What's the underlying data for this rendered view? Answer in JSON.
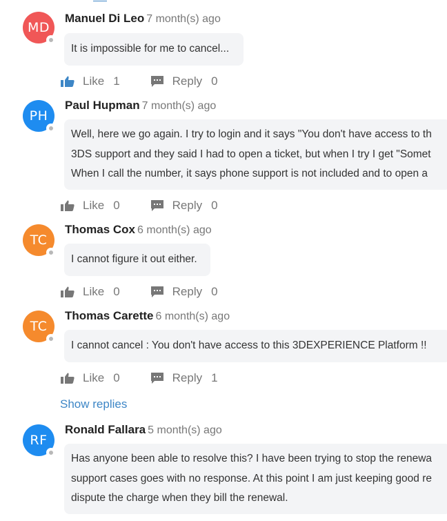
{
  "colors": {
    "avatar_red": "#f05757",
    "avatar_blue": "#1e8cf0",
    "avatar_orange": "#f58a2d",
    "link_blue": "#3d86c6",
    "like_active_blue": "#3d86c6",
    "icon_gray": "#777777",
    "bubble_bg": "#f3f4f6"
  },
  "labels": {
    "like": "Like",
    "reply": "Reply",
    "show_replies": "Show replies"
  },
  "comments": [
    {
      "initials": "MD",
      "author": "Manuel Di Leo",
      "time": "7 month(s) ago",
      "lines": [
        "It is impossible for me to cancel..."
      ],
      "likes": "1",
      "replies": "0",
      "liked": true
    },
    {
      "initials": "PH",
      "author": "Paul Hupman",
      "time": "7 month(s) ago",
      "lines": [
        "Well, here we go again. I try to login and it says \"You don't have access to th",
        "3DS support and they said I had to open a ticket, but when I try I get \"Somet",
        "When I call the number, it says phone support is not included and to open a"
      ],
      "likes": "0",
      "replies": "0",
      "liked": false
    },
    {
      "initials": "TC",
      "author": "Thomas Cox",
      "time": "6 month(s) ago",
      "lines": [
        "I cannot figure it out either."
      ],
      "likes": "0",
      "replies": "0",
      "liked": false
    },
    {
      "initials": "TC",
      "author": "Thomas Carette",
      "time": "6 month(s) ago",
      "lines": [
        "I cannot cancel : You don't have access to this 3DEXPERIENCE Platform !!"
      ],
      "likes": "0",
      "replies": "1",
      "liked": false
    },
    {
      "initials": "RF",
      "author": "Ronald Fallara",
      "time": "5 month(s) ago",
      "lines": [
        "Has anyone been able to resolve this? I have been trying to stop the renewa",
        "support cases goes with no response. At this point I am just keeping good re",
        "dispute the charge when they bill the renewal."
      ],
      "likes": null,
      "replies": null,
      "liked": false
    }
  ]
}
